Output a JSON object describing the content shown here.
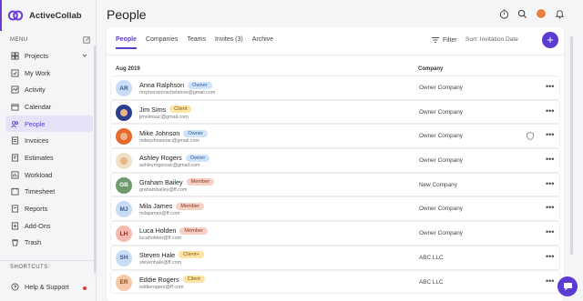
{
  "brand": {
    "name": "ActiveCollab"
  },
  "sidebar": {
    "menu_label": "MENU",
    "items": [
      {
        "label": "Projects",
        "icon": "projects-icon"
      },
      {
        "label": "My Work",
        "icon": "my-work-icon"
      },
      {
        "label": "Activity",
        "icon": "activity-icon"
      },
      {
        "label": "Calendar",
        "icon": "calendar-icon"
      },
      {
        "label": "People",
        "icon": "people-icon"
      },
      {
        "label": "Invoices",
        "icon": "invoices-icon"
      },
      {
        "label": "Estimates",
        "icon": "estimates-icon"
      },
      {
        "label": "Workload",
        "icon": "workload-icon"
      },
      {
        "label": "Timesheet",
        "icon": "timesheet-icon"
      },
      {
        "label": "Reports",
        "icon": "reports-icon"
      },
      {
        "label": "Add-Ons",
        "icon": "addons-icon"
      },
      {
        "label": "Trash",
        "icon": "trash-icon"
      }
    ],
    "shortcuts_label": "SHORTCUTS",
    "help_label": "Help & Support"
  },
  "header": {
    "title": "People"
  },
  "tabs": [
    {
      "label": "People"
    },
    {
      "label": "Companies"
    },
    {
      "label": "Teams"
    },
    {
      "label": "Invites (3)"
    },
    {
      "label": "Archive"
    }
  ],
  "toolbar": {
    "filter_label": "Filter",
    "sort_label": "Sort: Invitation Date",
    "add_label": "+"
  },
  "table": {
    "group_label": "Aug 2019",
    "company_header": "Company",
    "rows": [
      {
        "initials": "AR",
        "name": "Anna Ralphson",
        "role": "Owner",
        "email": "mcphersonrachelanne@gmail.com",
        "company": "Owner Company",
        "avatar_color": "#c9dcf6",
        "text_color": "#3b5a8a",
        "badge_bg": "#cfe3fb",
        "badge_fg": "#2c5f9c"
      },
      {
        "initials": "",
        "name": "Jim Sims",
        "role": "Client",
        "email": "jimsimsac@gmail.com",
        "company": "Owner Company",
        "avatar_color": "#2a3d8f",
        "text_color": "#fff",
        "badge_bg": "#fde3a6",
        "badge_fg": "#8a5a00"
      },
      {
        "initials": "",
        "name": "Mike Johnson",
        "role": "Owner",
        "email": "mikejohnsonac@gmail.com",
        "company": "Owner Company",
        "avatar_color": "#e86a2c",
        "text_color": "#fff",
        "badge_bg": "#cfe3fb",
        "badge_fg": "#2c5f9c",
        "shield": true
      },
      {
        "initials": "",
        "name": "Ashley Rogers",
        "role": "Owner",
        "email": "ashleyrogersac@gmail.com",
        "company": "Owner Company",
        "avatar_color": "#f1e0c8",
        "text_color": "#fff",
        "badge_bg": "#cfe3fb",
        "badge_fg": "#2c5f9c"
      },
      {
        "initials": "GB",
        "name": "Graham Bailey",
        "role": "Member",
        "email": "grahambailey@ff.com",
        "company": "New Company",
        "avatar_color": "#6d9a6f",
        "text_color": "#fff",
        "badge_bg": "#f8cfc4",
        "badge_fg": "#8a3a22"
      },
      {
        "initials": "MJ",
        "name": "Mila James",
        "role": "Member",
        "email": "milajames@ff.com",
        "company": "Owner Company",
        "avatar_color": "#c9dcf6",
        "text_color": "#3b5a8a",
        "badge_bg": "#f8cfc4",
        "badge_fg": "#8a3a22"
      },
      {
        "initials": "LH",
        "name": "Luca Holden",
        "role": "Member",
        "email": "lucaholden@ff.com",
        "company": "Owner Company",
        "avatar_color": "#f5b9b0",
        "text_color": "#8a2a22",
        "badge_bg": "#f8cfc4",
        "badge_fg": "#8a3a22"
      },
      {
        "initials": "SH",
        "name": "Steven Hale",
        "role": "Client+",
        "email": "stevenhale@ff.com",
        "company": "ABC LLC",
        "avatar_color": "#c9dcf6",
        "text_color": "#3b5a8a",
        "badge_bg": "#fde3a6",
        "badge_fg": "#8a5a00"
      },
      {
        "initials": "ER",
        "name": "Eddie Rogers",
        "role": "Client",
        "email": "eddierogers@ff.com",
        "company": "ABC LLC",
        "avatar_color": "#f7c9a8",
        "text_color": "#8a4a1a",
        "badge_bg": "#fde3a6",
        "badge_fg": "#8a5a00"
      }
    ]
  },
  "colors": {
    "accent": "#5b3bd1"
  }
}
